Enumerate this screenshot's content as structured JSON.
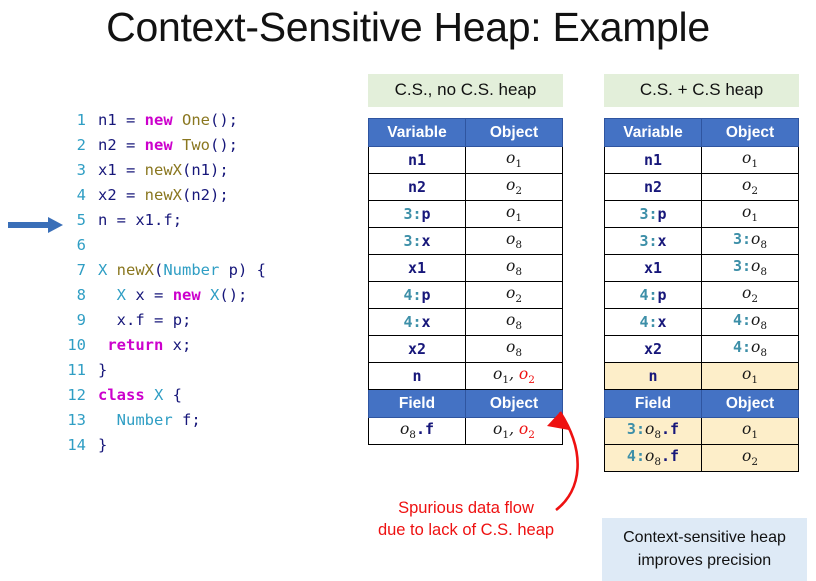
{
  "title": "Context-Sensitive Heap: Example",
  "code": {
    "current_line": 5,
    "lines": [
      {
        "num": "1",
        "tokens": [
          {
            "t": "n1 ",
            "c": "id"
          },
          {
            "t": "= ",
            "c": "punc"
          },
          {
            "t": "new ",
            "c": "kw"
          },
          {
            "t": "One",
            "c": "fn"
          },
          {
            "t": "();",
            "c": "punc"
          }
        ]
      },
      {
        "num": "2",
        "tokens": [
          {
            "t": "n2 ",
            "c": "id"
          },
          {
            "t": "= ",
            "c": "punc"
          },
          {
            "t": "new ",
            "c": "kw"
          },
          {
            "t": "Two",
            "c": "fn"
          },
          {
            "t": "();",
            "c": "punc"
          }
        ]
      },
      {
        "num": "3",
        "tokens": [
          {
            "t": "x1 ",
            "c": "id"
          },
          {
            "t": "= ",
            "c": "punc"
          },
          {
            "t": "newX",
            "c": "fn"
          },
          {
            "t": "(",
            "c": "punc"
          },
          {
            "t": "n1",
            "c": "id"
          },
          {
            "t": ");",
            "c": "punc"
          }
        ]
      },
      {
        "num": "4",
        "tokens": [
          {
            "t": "x2 ",
            "c": "id"
          },
          {
            "t": "= ",
            "c": "punc"
          },
          {
            "t": "newX",
            "c": "fn"
          },
          {
            "t": "(",
            "c": "punc"
          },
          {
            "t": "n2",
            "c": "id"
          },
          {
            "t": ");",
            "c": "punc"
          }
        ]
      },
      {
        "num": "5",
        "tokens": [
          {
            "t": "n ",
            "c": "id"
          },
          {
            "t": "= ",
            "c": "punc"
          },
          {
            "t": "x1",
            "c": "id"
          },
          {
            "t": ".",
            "c": "punc"
          },
          {
            "t": "f",
            "c": "id"
          },
          {
            "t": ";",
            "c": "punc"
          }
        ]
      },
      {
        "num": "6",
        "tokens": []
      },
      {
        "num": "7",
        "tokens": [
          {
            "t": "X ",
            "c": "ty"
          },
          {
            "t": "newX",
            "c": "fn"
          },
          {
            "t": "(",
            "c": "punc"
          },
          {
            "t": "Number ",
            "c": "ty"
          },
          {
            "t": "p",
            "c": "id"
          },
          {
            "t": ") {",
            "c": "punc"
          }
        ]
      },
      {
        "num": "8",
        "tokens": [
          {
            "t": "  ",
            "c": "punc"
          },
          {
            "t": "X ",
            "c": "ty"
          },
          {
            "t": "x ",
            "c": "id"
          },
          {
            "t": "= ",
            "c": "punc"
          },
          {
            "t": "new ",
            "c": "kw"
          },
          {
            "t": "X",
            "c": "ty"
          },
          {
            "t": "();",
            "c": "punc"
          }
        ]
      },
      {
        "num": "9",
        "tokens": [
          {
            "t": "  ",
            "c": "punc"
          },
          {
            "t": "x",
            "c": "id"
          },
          {
            "t": ".",
            "c": "punc"
          },
          {
            "t": "f ",
            "c": "id"
          },
          {
            "t": "= ",
            "c": "punc"
          },
          {
            "t": "p",
            "c": "id"
          },
          {
            "t": ";",
            "c": "punc"
          }
        ]
      },
      {
        "num": "10",
        "tokens": [
          {
            "t": " ",
            "c": "punc"
          },
          {
            "t": "return ",
            "c": "kw"
          },
          {
            "t": "x",
            "c": "id"
          },
          {
            "t": ";",
            "c": "punc"
          }
        ]
      },
      {
        "num": "11",
        "tokens": [
          {
            "t": "}",
            "c": "punc"
          }
        ]
      },
      {
        "num": "12",
        "tokens": [
          {
            "t": "class ",
            "c": "kw"
          },
          {
            "t": "X ",
            "c": "ty"
          },
          {
            "t": "{",
            "c": "punc"
          }
        ]
      },
      {
        "num": "13",
        "tokens": [
          {
            "t": "  ",
            "c": "punc"
          },
          {
            "t": "Number ",
            "c": "ty"
          },
          {
            "t": "f",
            "c": "id"
          },
          {
            "t": ";",
            "c": "punc"
          }
        ]
      },
      {
        "num": "14",
        "tokens": [
          {
            "t": "}",
            "c": "punc"
          }
        ]
      }
    ]
  },
  "left_table": {
    "caption": "C.S., no C.S. heap",
    "var_headers": [
      "Variable",
      "Object"
    ],
    "var_rows": [
      {
        "variable": [
          {
            "t": "n1",
            "c": "var"
          }
        ],
        "object": [
          {
            "t": "o",
            "s": "1",
            "c": "obj"
          }
        ],
        "highlight": false
      },
      {
        "variable": [
          {
            "t": "n2",
            "c": "var"
          }
        ],
        "object": [
          {
            "t": "o",
            "s": "2",
            "c": "obj"
          }
        ],
        "highlight": false
      },
      {
        "variable": [
          {
            "t": "3:",
            "c": "ctx"
          },
          {
            "t": "p",
            "c": "var"
          }
        ],
        "object": [
          {
            "t": "o",
            "s": "1",
            "c": "obj"
          }
        ],
        "highlight": false
      },
      {
        "variable": [
          {
            "t": "3:",
            "c": "ctx"
          },
          {
            "t": "x",
            "c": "var"
          }
        ],
        "object": [
          {
            "t": "o",
            "s": "8",
            "c": "obj"
          }
        ],
        "highlight": false
      },
      {
        "variable": [
          {
            "t": "x1",
            "c": "var"
          }
        ],
        "object": [
          {
            "t": "o",
            "s": "8",
            "c": "obj"
          }
        ],
        "highlight": false
      },
      {
        "variable": [
          {
            "t": "4:",
            "c": "ctx"
          },
          {
            "t": "p",
            "c": "var"
          }
        ],
        "object": [
          {
            "t": "o",
            "s": "2",
            "c": "obj"
          }
        ],
        "highlight": false
      },
      {
        "variable": [
          {
            "t": "4:",
            "c": "ctx"
          },
          {
            "t": "x",
            "c": "var"
          }
        ],
        "object": [
          {
            "t": "o",
            "s": "8",
            "c": "obj"
          }
        ],
        "highlight": false
      },
      {
        "variable": [
          {
            "t": "x2",
            "c": "var"
          }
        ],
        "object": [
          {
            "t": "o",
            "s": "8",
            "c": "obj"
          }
        ],
        "highlight": false
      },
      {
        "variable": [
          {
            "t": "n",
            "c": "var"
          }
        ],
        "object": [
          {
            "t": "o",
            "s": "1",
            "c": "obj"
          },
          {
            "t": ", ",
            "c": "obj"
          },
          {
            "t": "o",
            "s": "2",
            "c": "obj obj-red"
          }
        ],
        "highlight": false
      }
    ],
    "field_headers": [
      "Field",
      "Object"
    ],
    "field_rows": [
      {
        "field": [
          {
            "t": "o",
            "s": "8",
            "c": "obj"
          },
          {
            "t": ".f",
            "c": "fld"
          }
        ],
        "object": [
          {
            "t": "o",
            "s": "1",
            "c": "obj"
          },
          {
            "t": ", ",
            "c": "obj"
          },
          {
            "t": "o",
            "s": "2",
            "c": "obj obj-red"
          }
        ],
        "highlight": false
      }
    ]
  },
  "right_table": {
    "caption": "C.S. + C.S heap",
    "var_headers": [
      "Variable",
      "Object"
    ],
    "var_rows": [
      {
        "variable": [
          {
            "t": "n1",
            "c": "var"
          }
        ],
        "object": [
          {
            "t": "o",
            "s": "1",
            "c": "obj"
          }
        ],
        "highlight": false
      },
      {
        "variable": [
          {
            "t": "n2",
            "c": "var"
          }
        ],
        "object": [
          {
            "t": "o",
            "s": "2",
            "c": "obj"
          }
        ],
        "highlight": false
      },
      {
        "variable": [
          {
            "t": "3:",
            "c": "ctx"
          },
          {
            "t": "p",
            "c": "var"
          }
        ],
        "object": [
          {
            "t": "o",
            "s": "1",
            "c": "obj"
          }
        ],
        "highlight": false
      },
      {
        "variable": [
          {
            "t": "3:",
            "c": "ctx"
          },
          {
            "t": "x",
            "c": "var"
          }
        ],
        "object": [
          {
            "t": "3:",
            "c": "ctx"
          },
          {
            "t": "o",
            "s": "8",
            "c": "obj"
          }
        ],
        "highlight": false
      },
      {
        "variable": [
          {
            "t": "x1",
            "c": "var"
          }
        ],
        "object": [
          {
            "t": "3:",
            "c": "ctx"
          },
          {
            "t": "o",
            "s": "8",
            "c": "obj"
          }
        ],
        "highlight": false
      },
      {
        "variable": [
          {
            "t": "4:",
            "c": "ctx"
          },
          {
            "t": "p",
            "c": "var"
          }
        ],
        "object": [
          {
            "t": "o",
            "s": "2",
            "c": "obj"
          }
        ],
        "highlight": false
      },
      {
        "variable": [
          {
            "t": "4:",
            "c": "ctx"
          },
          {
            "t": "x",
            "c": "var"
          }
        ],
        "object": [
          {
            "t": "4:",
            "c": "ctx"
          },
          {
            "t": "o",
            "s": "8",
            "c": "obj"
          }
        ],
        "highlight": false
      },
      {
        "variable": [
          {
            "t": "x2",
            "c": "var"
          }
        ],
        "object": [
          {
            "t": "4:",
            "c": "ctx"
          },
          {
            "t": "o",
            "s": "8",
            "c": "obj"
          }
        ],
        "highlight": false
      },
      {
        "variable": [
          {
            "t": "n",
            "c": "var"
          }
        ],
        "object": [
          {
            "t": "o",
            "s": "1",
            "c": "obj"
          }
        ],
        "highlight": true
      }
    ],
    "field_headers": [
      "Field",
      "Object"
    ],
    "field_rows": [
      {
        "field": [
          {
            "t": "3:",
            "c": "ctx"
          },
          {
            "t": "o",
            "s": "8",
            "c": "obj"
          },
          {
            "t": ".f",
            "c": "fld"
          }
        ],
        "object": [
          {
            "t": "o",
            "s": "1",
            "c": "obj"
          }
        ],
        "highlight": true
      },
      {
        "field": [
          {
            "t": "4:",
            "c": "ctx"
          },
          {
            "t": "o",
            "s": "8",
            "c": "obj"
          },
          {
            "t": ".f",
            "c": "fld"
          }
        ],
        "object": [
          {
            "t": "o",
            "s": "2",
            "c": "obj"
          }
        ],
        "highlight": true
      }
    ]
  },
  "annotations": {
    "spurious_note_line1": "Spurious data flow",
    "spurious_note_line2": "due to lack of C.S. heap",
    "conclusion_line1": "Context-sensitive heap",
    "conclusion_line2": "improves precision"
  },
  "colors": {
    "header_blue": "#4472C4",
    "caption_green": "#E3EFDA",
    "highlight_cream": "#FDEEC9",
    "conclusion_blue": "#DEEAF6",
    "alert_red": "#EE1111",
    "context_teal": "#3D8FA8",
    "identifier_navy": "#17177A"
  }
}
